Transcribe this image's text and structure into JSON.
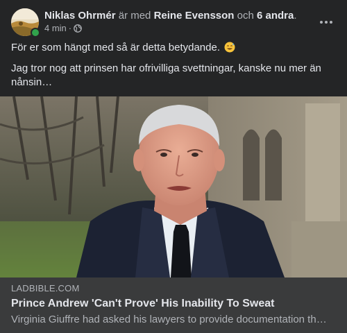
{
  "post": {
    "author": "Niklas Ohrmér",
    "with_text": "är med",
    "tagged": "Reine Evensson",
    "and_text": "och",
    "others": "6 andra",
    "time": "4 min",
    "separator": "·",
    "audience_icon": "globe-icon",
    "text_1": "För er som hängt med så är detta betydande.",
    "text_1_emoji": "sweat-smile-emoji",
    "text_2": "Jag tror nog att prinsen har ofrivilliga svettningar, kanske nu mer än nånsin…"
  },
  "link_preview": {
    "domain": "LADBIBLE.COM",
    "title": "Prince Andrew 'Can't Prove' His Inability To Sweat",
    "description": "Virginia Giuffre had asked his lawyers to provide documentation th…"
  },
  "colors": {
    "background": "#242526",
    "link_background": "#3a3b3c",
    "primary_text": "#e4e6eb",
    "secondary_text": "#b0b3b8",
    "online": "#31a24c"
  }
}
